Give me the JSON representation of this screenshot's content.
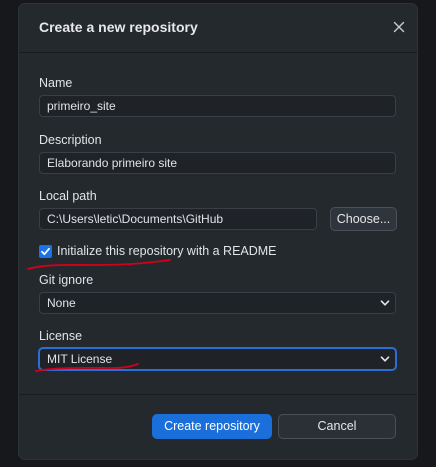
{
  "dialog": {
    "title": "Create a new repository",
    "close_icon": "close-icon"
  },
  "fields": {
    "name": {
      "label": "Name",
      "value": "primeiro_site"
    },
    "description": {
      "label": "Description",
      "value": "Elaborando primeiro site"
    },
    "local_path": {
      "label": "Local path",
      "value": "C:\\Users\\letic\\Documents\\GitHub",
      "button": "Choose..."
    },
    "readme": {
      "label": "Initialize this repository with a README",
      "checked": true
    },
    "git_ignore": {
      "label": "Git ignore",
      "value": "None"
    },
    "license": {
      "label": "License",
      "value": "MIT License"
    }
  },
  "footer": {
    "create_label": "Create repository",
    "cancel_label": "Cancel"
  },
  "colors": {
    "accent": "#1a6fdb",
    "annotation": "#d0021b"
  }
}
